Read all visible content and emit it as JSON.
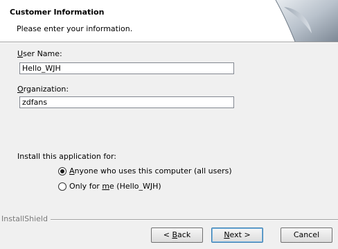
{
  "banner": {
    "title": "Customer Information",
    "subtitle": "Please enter your information."
  },
  "form": {
    "user_name_label_prefix": "U",
    "user_name_label_rest": "ser Name:",
    "user_name_value": "Hello_WJH",
    "organization_label_prefix": "O",
    "organization_label_rest": "rganization:",
    "organization_value": "zdfans",
    "install_for_label": "Install this application for:",
    "options": [
      {
        "prefix": "A",
        "rest": "nyone who uses this computer (all users)",
        "selected": true
      },
      {
        "before": "Only for ",
        "mnemonic": "m",
        "after": "e (Hello_WJH)",
        "selected": false
      }
    ]
  },
  "footer": {
    "brand": "InstallShield",
    "back_prefix": "< ",
    "back_mnemonic": "B",
    "back_rest": "ack",
    "next_mnemonic": "N",
    "next_rest": "ext >",
    "cancel_label": "Cancel"
  }
}
